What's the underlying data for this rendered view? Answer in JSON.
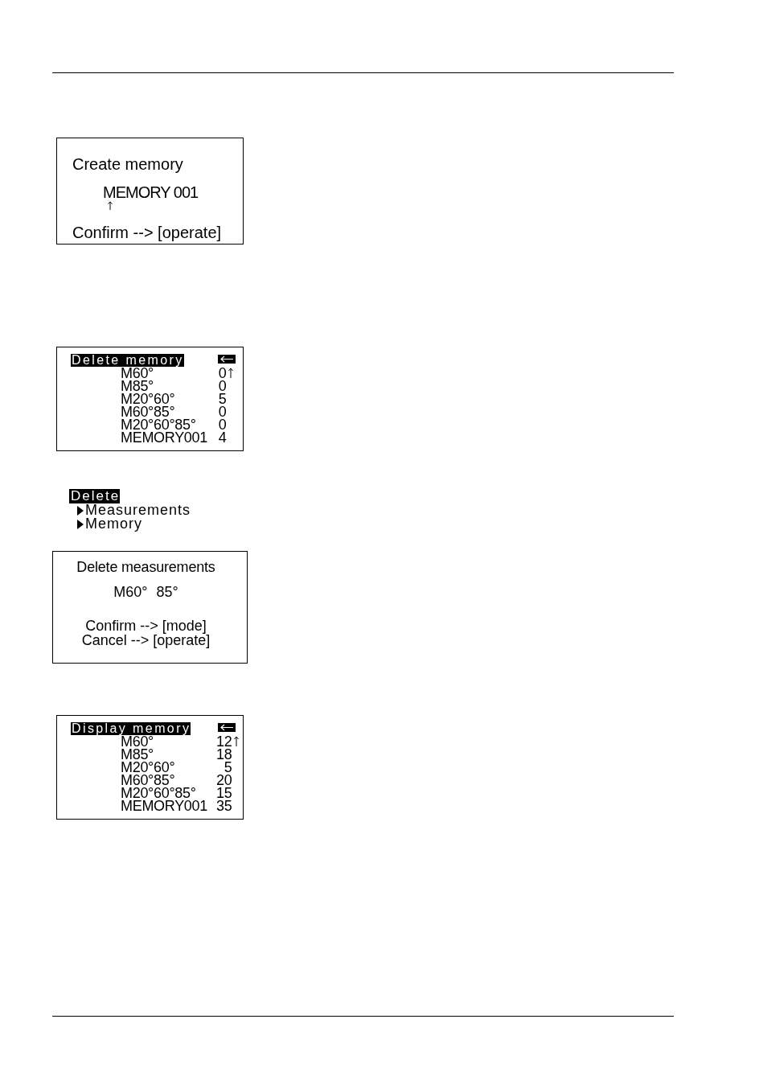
{
  "screens": [
    {
      "kind": "dialog",
      "title": "Create memory",
      "value": "MEMORY 001",
      "prompts": [
        "Confirm --> [operate]"
      ]
    },
    {
      "kind": "list",
      "title": "Delete memory",
      "rows": [
        {
          "label": "M60°",
          "value": "0"
        },
        {
          "label": "M85°",
          "value": "0"
        },
        {
          "label": "M20°60°",
          "value": "5"
        },
        {
          "label": "M60°85°",
          "value": "0"
        },
        {
          "label": "M20°60°85°",
          "value": "0"
        },
        {
          "label": "MEMORY001",
          "value": "4"
        }
      ]
    },
    {
      "kind": "menu",
      "title": "Delete",
      "items": [
        "Measurements",
        "Memory"
      ]
    },
    {
      "kind": "confirm",
      "title": "Delete measurements",
      "value": "M60° 85°",
      "prompts": [
        "Confirm --> [mode]",
        "Cancel --> [operate]"
      ]
    },
    {
      "kind": "list",
      "title": "Display memory",
      "rows": [
        {
          "label": "M60°",
          "value": "12"
        },
        {
          "label": "M85°",
          "value": "18"
        },
        {
          "label": "M20°60°",
          "value": "5"
        },
        {
          "label": "M60°85°",
          "value": "20"
        },
        {
          "label": "M20°60°85°",
          "value": "15"
        },
        {
          "label": "MEMORY001",
          "value": "35"
        }
      ]
    }
  ]
}
